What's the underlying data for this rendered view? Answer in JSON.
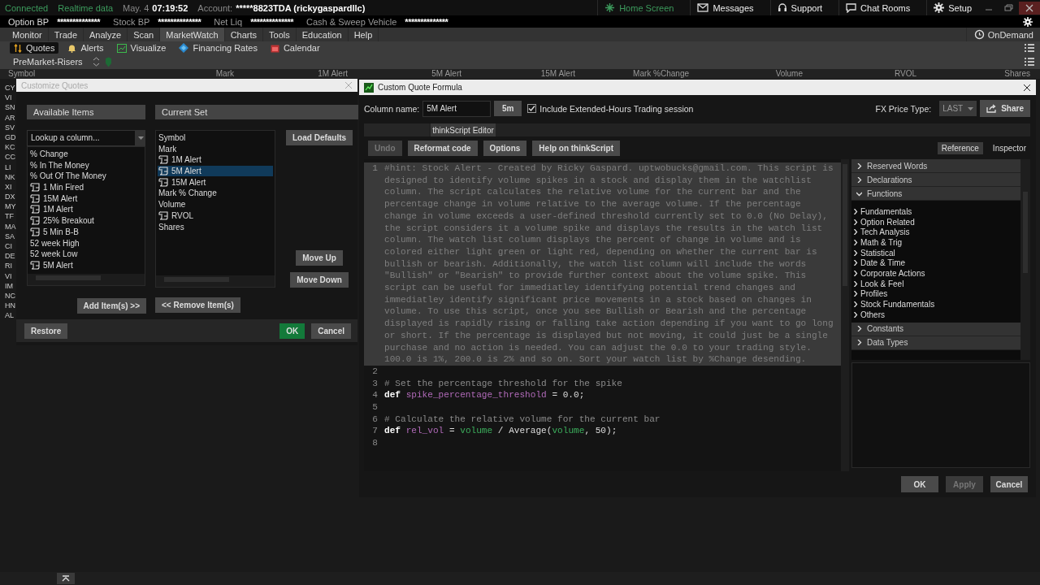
{
  "status": {
    "connection": "Connected",
    "feed": "Realtime data",
    "date": "May. 4",
    "time": "07:19:52",
    "account_label": "Account:",
    "account": "*****8823TDA (rickygaspardllc)"
  },
  "top_links": [
    {
      "label": "Home Screen",
      "kind": "home"
    },
    {
      "label": "Messages",
      "kind": "mail"
    },
    {
      "label": "Support",
      "kind": "headset"
    },
    {
      "label": "Chat Rooms",
      "kind": "chat"
    },
    {
      "label": "Setup",
      "kind": "gear"
    }
  ],
  "balances": [
    {
      "label": "Option BP",
      "value": "**************"
    },
    {
      "label": "Stock BP",
      "value": "**************"
    },
    {
      "label": "Net Liq",
      "value": "**************"
    },
    {
      "label": "Cash & Sweep Vehicle",
      "value": "**************"
    }
  ],
  "menu": [
    {
      "label": "Monitor",
      "selected": false
    },
    {
      "label": "Trade",
      "selected": false
    },
    {
      "label": "Analyze",
      "selected": false
    },
    {
      "label": "Scan",
      "selected": false
    },
    {
      "label": "MarketWatch",
      "selected": true
    },
    {
      "label": "Charts",
      "selected": false
    },
    {
      "label": "Tools",
      "selected": false
    },
    {
      "label": "Education",
      "selected": false
    },
    {
      "label": "Help",
      "selected": false
    }
  ],
  "on_demand": "OnDemand",
  "subtabs": [
    {
      "label": "Quotes",
      "kind": "quotes",
      "selected": true
    },
    {
      "label": "Alerts",
      "kind": "bell",
      "selected": false
    },
    {
      "label": "Visualize",
      "kind": "chart",
      "selected": false
    },
    {
      "label": "Financing Rates",
      "kind": "diamond",
      "selected": false
    },
    {
      "label": "Calendar",
      "kind": "calendar",
      "selected": false
    }
  ],
  "watchlist": {
    "name": "PreMarket-Risers",
    "columns": [
      "Symbol",
      "Mark",
      "1M Alert",
      "5M Alert",
      "15M Alert",
      "Mark %Change",
      "Volume",
      "RVOL",
      "Shares"
    ],
    "symbols": [
      "CY",
      "VI",
      "SN",
      "AR",
      "SV",
      "GD",
      "KC",
      "CC",
      "LI",
      "NK",
      "XI",
      "DX",
      "MY",
      "TF",
      "MA",
      "SA",
      "CI",
      "DE",
      "RI",
      "VI",
      "IM",
      "NC",
      "HN",
      "AL"
    ]
  },
  "customize": {
    "title": "Customize Quotes",
    "available_header": "Available Items",
    "lookup_placeholder": "Lookup a column...",
    "current_header": "Current Set",
    "available": [
      {
        "label": "% Change",
        "kind": "plain"
      },
      {
        "label": "% In The Money",
        "kind": "plain"
      },
      {
        "label": "% Out Of The Money",
        "kind": "plain"
      },
      {
        "label": "1 Min Fired",
        "kind": "script"
      },
      {
        "label": "15M Alert",
        "kind": "script"
      },
      {
        "label": "1M Alert",
        "kind": "script"
      },
      {
        "label": "25% Breakout",
        "kind": "script"
      },
      {
        "label": "5 Min B-B",
        "kind": "script"
      },
      {
        "label": "52 week High",
        "kind": "plain"
      },
      {
        "label": "52 week Low",
        "kind": "plain"
      },
      {
        "label": "5M Alert",
        "kind": "script"
      }
    ],
    "current": [
      {
        "label": "Symbol",
        "kind": "plain",
        "selected": false
      },
      {
        "label": "Mark",
        "kind": "plain",
        "selected": false
      },
      {
        "label": "1M Alert",
        "kind": "script",
        "selected": false
      },
      {
        "label": "5M Alert",
        "kind": "script",
        "selected": true
      },
      {
        "label": "15M Alert",
        "kind": "script",
        "selected": false
      },
      {
        "label": "Mark % Change",
        "kind": "plain",
        "selected": false
      },
      {
        "label": "Volume",
        "kind": "plain",
        "selected": false
      },
      {
        "label": "RVOL",
        "kind": "script",
        "selected": false
      },
      {
        "label": "Shares",
        "kind": "plain",
        "selected": false
      }
    ],
    "load_defaults": "Load Defaults",
    "move_up": "Move Up",
    "move_down": "Move Down",
    "add": "Add Item(s) >>",
    "remove": "<< Remove Item(s)",
    "restore": "Restore",
    "ok": "OK",
    "cancel": "Cancel"
  },
  "formula": {
    "title": "Custom Quote Formula",
    "column_name_label": "Column name:",
    "column_name": "5M Alert",
    "aggregation": "5m",
    "extended_hours": {
      "label": "Include Extended-Hours Trading session",
      "checked": true
    },
    "fx_label": "FX Price Type:",
    "fx_value": "LAST",
    "share": "Share",
    "tabs": [
      {
        "label": "thinkScript Editor",
        "selected": true
      }
    ],
    "toolbar": [
      {
        "label": "Undo",
        "disabled": true
      },
      {
        "label": "Reformat code",
        "disabled": false
      },
      {
        "label": "Options",
        "disabled": false
      },
      {
        "label": "Help on thinkScript",
        "disabled": false
      }
    ],
    "side_tabs": [
      {
        "label": "Reference",
        "selected": true
      },
      {
        "label": "Inspector",
        "selected": false
      }
    ],
    "lines": [
      {
        "number": "1",
        "kind": "hint",
        "text": "#hint: Stock Alert - Created by Ricky Gaspard. uptwobucks@gmail.com. This script is designed to identify volume spikes in a stock and display them in the watchlist column. The script calculates the relative volume for the current bar and the percentage change in volume relative to the average volume. If the percentage change in volume exceeds a user-defined threshold currently set to 0.0 (No Delay), the script considers it a volume spike and displays the results in the watch list column. The watch list column displays the percent of change in volume and is colored either light green or light red, depending on whether the current bar is bullish or bearish. Additionally, the watch list column will include the words \"Bullish\" or \"Bearish\" to provide further context about the volume spike. This script can be useful for immediatley identifying potential trend changes and immediatley identify significant price movements in a stock based on changes in volume. To use this script, once you see Bullish or Bearish and the percentage displayed is rapidly rising or falling take action depending if you want to go long or short. If the percentage is displayed but not moving, it could just be a single purchase and no action is needed. You can adjust the 0.0 to your trading style. 100.0 is 1%, 200.0 is 2% and so on. Sort your watch list by %Change desending."
      },
      {
        "number": "2",
        "kind": "code"
      },
      {
        "number": "3",
        "kind": "code",
        "tokens": [
          {
            "kind": "comment",
            "text": "# Set the percentage threshold for the spike"
          }
        ]
      },
      {
        "number": "4",
        "kind": "code",
        "tokens": [
          {
            "kind": "keyword",
            "text": "def "
          },
          {
            "kind": "variable",
            "text": "spike_percentage_threshold"
          },
          {
            "kind": "plain",
            "text": " = 0.0;"
          }
        ]
      },
      {
        "number": "5",
        "kind": "code"
      },
      {
        "number": "6",
        "kind": "code",
        "tokens": [
          {
            "kind": "comment",
            "text": "# Calculate the relative volume for the current bar"
          }
        ]
      },
      {
        "number": "7",
        "kind": "code",
        "tokens": [
          {
            "kind": "keyword",
            "text": "def "
          },
          {
            "kind": "variable",
            "text": "rel_vol"
          },
          {
            "kind": "plain",
            "text": " = "
          },
          {
            "kind": "builtin",
            "text": "volume"
          },
          {
            "kind": "plain",
            "text": " / Average("
          },
          {
            "kind": "builtin",
            "text": "volume"
          },
          {
            "kind": "plain",
            "text": ", 50);"
          }
        ]
      },
      {
        "number": "8",
        "kind": "code"
      }
    ],
    "reference": [
      {
        "label": "Reserved Words",
        "expanded": false
      },
      {
        "label": "Declarations",
        "expanded": false
      },
      {
        "label": "Functions",
        "expanded": true,
        "children": [
          {
            "label": "Fundamentals",
            "expanded": false
          },
          {
            "label": "Option Related",
            "expanded": false
          },
          {
            "label": "Tech Analysis",
            "expanded": false
          },
          {
            "label": "Math & Trig",
            "expanded": false
          },
          {
            "label": "Statistical",
            "expanded": false
          },
          {
            "label": "Date & Time",
            "expanded": false
          },
          {
            "label": "Corporate Actions",
            "expanded": false
          },
          {
            "label": "Look & Feel",
            "expanded": false
          },
          {
            "label": "Profiles",
            "expanded": false
          },
          {
            "label": "Stock Fundamentals",
            "expanded": false
          },
          {
            "label": "Others",
            "expanded": false
          }
        ]
      },
      {
        "label": "Constants",
        "expanded": false
      },
      {
        "label": "Data Types",
        "expanded": false
      }
    ],
    "buttons": [
      {
        "label": "OK",
        "disabled": false
      },
      {
        "label": "Apply",
        "disabled": true
      },
      {
        "label": "Cancel",
        "disabled": false
      }
    ]
  }
}
